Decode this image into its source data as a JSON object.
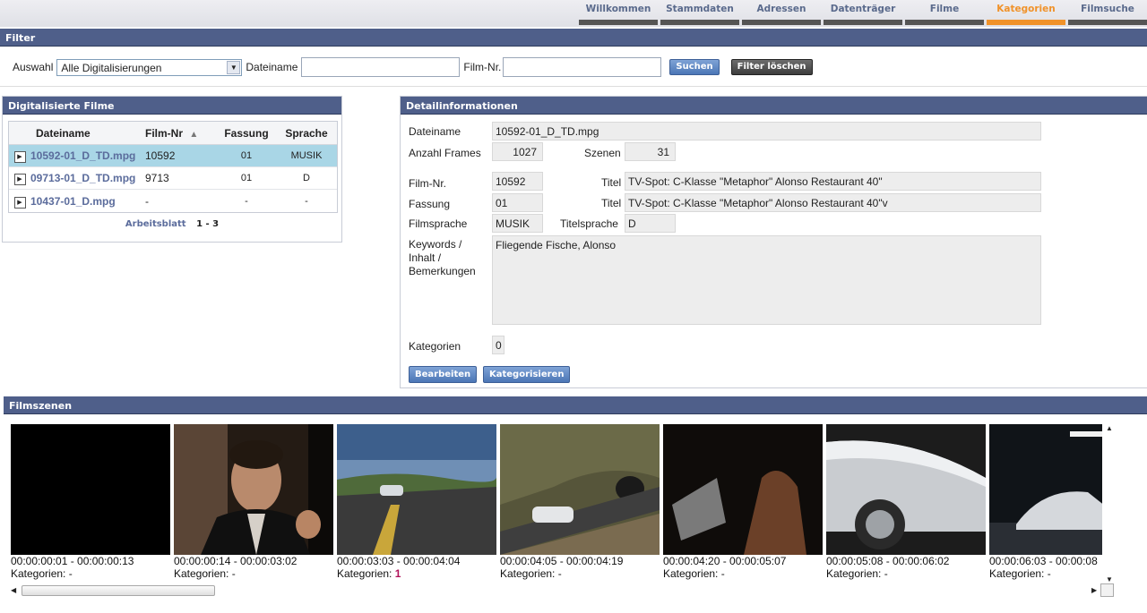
{
  "nav": {
    "items": [
      "Willkommen",
      "Stammdaten",
      "Adressen",
      "Datenträger",
      "Filme",
      "Kategorien",
      "Filmsuche"
    ],
    "active": "Kategorien"
  },
  "filter": {
    "title": "Filter",
    "auswahl_label": "Auswahl",
    "auswahl_value": "Alle Digitalisierungen",
    "dateiname_label": "Dateiname",
    "dateiname_value": "",
    "filmnr_label": "Film-Nr.",
    "filmnr_value": "",
    "search_label": "Suchen",
    "clear_label": "Filter löschen"
  },
  "films": {
    "title": "Digitalisierte Filme",
    "columns": [
      "Dateiname",
      "Film-Nr",
      "Fassung",
      "Sprache"
    ],
    "sort_indicator": "▲",
    "rows": [
      {
        "dateiname": "10592-01_D_TD.mpg",
        "filmnr": "10592",
        "fassung": "01",
        "sprache": "MUSIK",
        "selected": true
      },
      {
        "dateiname": "09713-01_D_TD.mpg",
        "filmnr": "9713",
        "fassung": "01",
        "sprache": "D",
        "selected": false
      },
      {
        "dateiname": "10437-01_D.mpg",
        "filmnr": "-",
        "fassung": "-",
        "sprache": "-",
        "selected": false
      }
    ],
    "pager_label": "Arbeitsblatt",
    "pager_range": "1 - 3"
  },
  "detail": {
    "title": "Detailinformationen",
    "dateiname_label": "Dateiname",
    "dateiname": "10592-01_D_TD.mpg",
    "frames_label": "Anzahl Frames",
    "frames": "1027",
    "szenen_label": "Szenen",
    "szenen": "31",
    "filmnr_label": "Film-Nr.",
    "filmnr": "10592",
    "titel_label": "Titel",
    "titel": "TV-Spot: C-Klasse \"Metaphor\" Alonso Restaurant 40\"",
    "fassung_label": "Fassung",
    "fassung": "01",
    "titel2_label": "Titel",
    "titel2": "TV-Spot: C-Klasse \"Metaphor\" Alonso Restaurant 40\"v",
    "filmsprache_label": "Filmsprache",
    "filmsprache": "MUSIK",
    "titelsprache_label": "Titelsprache",
    "titelsprache": "D",
    "keywords_label_1": "Keywords /",
    "keywords_label_2": "Inhalt /",
    "keywords_label_3": "Bemerkungen",
    "keywords": "Fliegende Fische, Alonso",
    "kategorien_label": "Kategorien",
    "kategorien": "0",
    "edit_label": "Bearbeiten",
    "categorize_label": "Kategorisieren"
  },
  "scenes": {
    "title": "Filmszenen",
    "kat_label": "Kategorien:",
    "items": [
      {
        "time": "00:00:00:01 - 00:00:00:13",
        "kategorien": "-"
      },
      {
        "time": "00:00:00:14 - 00:00:03:02",
        "kategorien": "-"
      },
      {
        "time": "00:00:03:03 - 00:00:04:04",
        "kategorien": "1"
      },
      {
        "time": "00:00:04:05 - 00:00:04:19",
        "kategorien": "-"
      },
      {
        "time": "00:00:04:20 - 00:00:05:07",
        "kategorien": "-"
      },
      {
        "time": "00:00:05:08 - 00:00:06:02",
        "kategorien": "-"
      },
      {
        "time": "00:00:06:03 - 00:00:08",
        "kategorien": "-"
      }
    ]
  },
  "colors": {
    "accent": "#f0922a",
    "bar": "#4f5f8a",
    "selected_row": "#a9d6e6",
    "link": "#5b6c9c"
  }
}
